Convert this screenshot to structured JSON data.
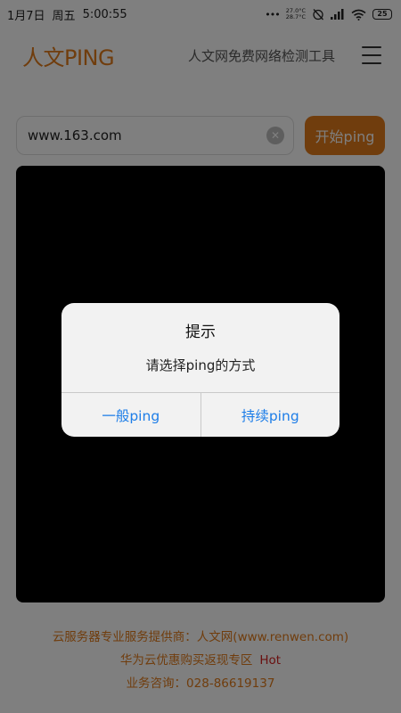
{
  "status_bar": {
    "date": "1月7日",
    "weekday": "周五",
    "time": "5:00:55",
    "temp_high": "27.0°C",
    "temp_low": "28.7°C",
    "battery": "25"
  },
  "header": {
    "logo": "人文PING",
    "tagline": "人文网免费网络检测工具"
  },
  "search": {
    "value": "www.163.com",
    "start_label": "开始ping"
  },
  "footer": {
    "line1": "云服务器专业服务提供商：人文网(www.renwen.com)",
    "line2": "华为云优惠购买返现专区",
    "hot": "Hot",
    "line3": "业务咨询：028-86619137"
  },
  "dialog": {
    "title": "提示",
    "message": "请选择ping的方式",
    "normal_label": "一般ping",
    "continuous_label": "持续ping"
  },
  "colors": {
    "accent": "#e07a1a",
    "link_blue": "#1e7ee8",
    "hot_red": "#d42020"
  }
}
